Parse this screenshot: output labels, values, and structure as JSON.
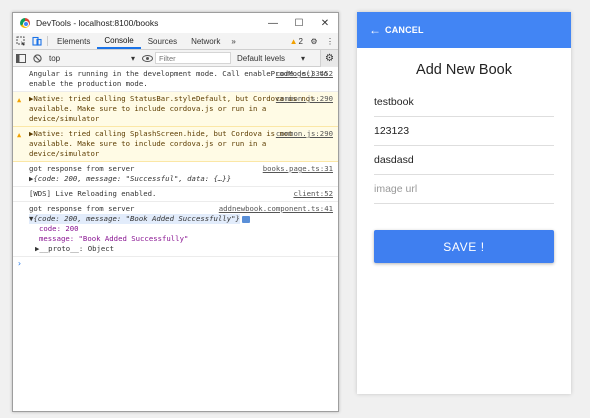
{
  "devtools": {
    "window_title": "DevTools - localhost:8100/books",
    "tabs": [
      "Elements",
      "Console",
      "Sources",
      "Network"
    ],
    "more_tabs": "»",
    "warning_count": "2",
    "context": "top",
    "filter_placeholder": "Filter",
    "levels": "Default levels",
    "messages": [
      {
        "type": "log",
        "text": "Angular is running in the development mode. Call enableProdMode() to enable the production mode.",
        "source": "core.js:33452"
      },
      {
        "type": "warn",
        "text": "▶Native: tried calling StatusBar.styleDefault, but Cordova is not available. Make sure to include cordova.js or run in a device/simulator",
        "source": "common.js:290"
      },
      {
        "type": "warn",
        "text": "▶Native: tried calling SplashScreen.hide, but Cordova is not available. Make sure to include cordova.js or run in a device/simulator",
        "source": "common.js:290"
      },
      {
        "type": "log",
        "text": "got response from server",
        "source": "books.page.ts:31",
        "object_preview": "▶{code: 200, message: \"Successful\", data: {…}}"
      },
      {
        "type": "log",
        "text": "[WDS] Live Reloading enabled.",
        "source": "client:52"
      },
      {
        "type": "log",
        "text": "got response from server",
        "source": "addnewbook.component.ts:41",
        "object_preview": "▼{code: 200, message: \"Book Added Successfully\"}",
        "props": [
          "code: 200",
          "message: \"Book Added Successfully\""
        ],
        "proto": "▶__proto__: Object"
      }
    ],
    "prompt": "›"
  },
  "app": {
    "cancel_label": "CANCEL",
    "title": "Add New Book",
    "fields": [
      {
        "value": "testbook",
        "placeholder": ""
      },
      {
        "value": "123123",
        "placeholder": ""
      },
      {
        "value": "dasdasd",
        "placeholder": ""
      },
      {
        "value": "",
        "placeholder": "image url"
      }
    ],
    "save_label": "SAVE !",
    "accent_color": "#4285f4"
  }
}
